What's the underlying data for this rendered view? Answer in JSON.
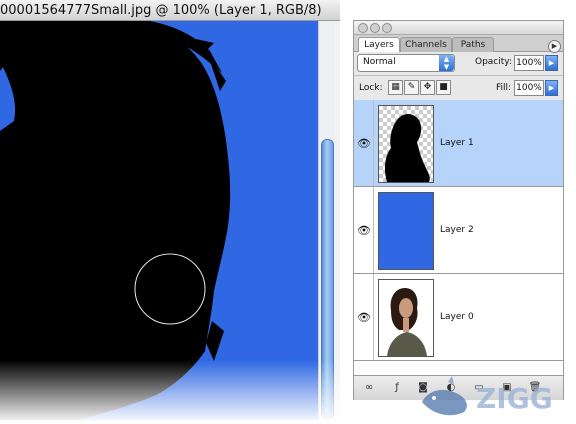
{
  "document": {
    "title": "00001564777Small.jpg @ 100% (Layer 1, RGB/8)"
  },
  "colors": {
    "canvas_blue": "#2f68e2",
    "selected_row": "#b6d3fa"
  },
  "palette": {
    "tabs": [
      {
        "label": "Layers",
        "active": true
      },
      {
        "label": "Channels",
        "active": false
      },
      {
        "label": "Paths",
        "active": false
      }
    ],
    "blend_mode": "Normal",
    "opacity_label": "Opacity:",
    "opacity_value": "100%",
    "lock_label": "Lock:",
    "fill_label": "Fill:",
    "fill_value": "100%",
    "layers": [
      {
        "name": "Layer 1",
        "selected": true,
        "visible": true,
        "thumbnail": "silhouette-on-transparent"
      },
      {
        "name": "Layer 2",
        "selected": false,
        "visible": true,
        "thumbnail": "solid-blue"
      },
      {
        "name": "Layer 0",
        "selected": false,
        "visible": true,
        "thumbnail": "woman-photo"
      }
    ],
    "bottom_icons": [
      "link-icon",
      "layer-style-icon",
      "mask-icon",
      "adjustment-icon",
      "folder-icon",
      "new-layer-icon",
      "trash-icon"
    ]
  },
  "watermark": {
    "text": "ZIGG"
  }
}
